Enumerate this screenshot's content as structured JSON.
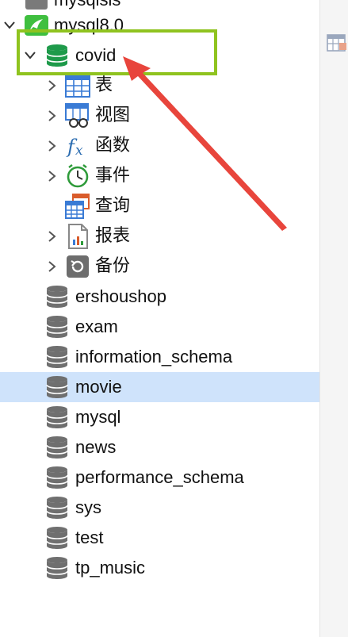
{
  "tree": {
    "partial_top_item": {
      "label": "mysqlsis"
    },
    "connection": {
      "label": "mysql8.0"
    },
    "selected_db": {
      "label": "covid"
    },
    "children": [
      {
        "label": "表"
      },
      {
        "label": "视图"
      },
      {
        "label": "函数"
      },
      {
        "label": "事件"
      },
      {
        "label": "查询"
      },
      {
        "label": "报表"
      },
      {
        "label": "备份"
      }
    ],
    "databases": [
      {
        "label": "ershoushop"
      },
      {
        "label": "exam"
      },
      {
        "label": "information_schema"
      },
      {
        "label": "movie"
      },
      {
        "label": "mysql"
      },
      {
        "label": "news"
      },
      {
        "label": "performance_schema"
      },
      {
        "label": "sys"
      },
      {
        "label": "test"
      },
      {
        "label": "tp_music"
      }
    ]
  },
  "icons": {
    "connection": "mysql-connection-icon",
    "database_open": "database-open-icon",
    "database": "database-icon",
    "table": "table-icon",
    "view": "view-icon",
    "function": "function-icon",
    "event": "event-icon",
    "query": "query-icon",
    "report": "report-icon",
    "backup": "backup-icon"
  },
  "colors": {
    "selection": "#cfe3fb",
    "highlight_box": "#8fc31f",
    "arrow": "#e8453c",
    "database_open": "#1e9a4a",
    "database": "#6f6f6f"
  }
}
